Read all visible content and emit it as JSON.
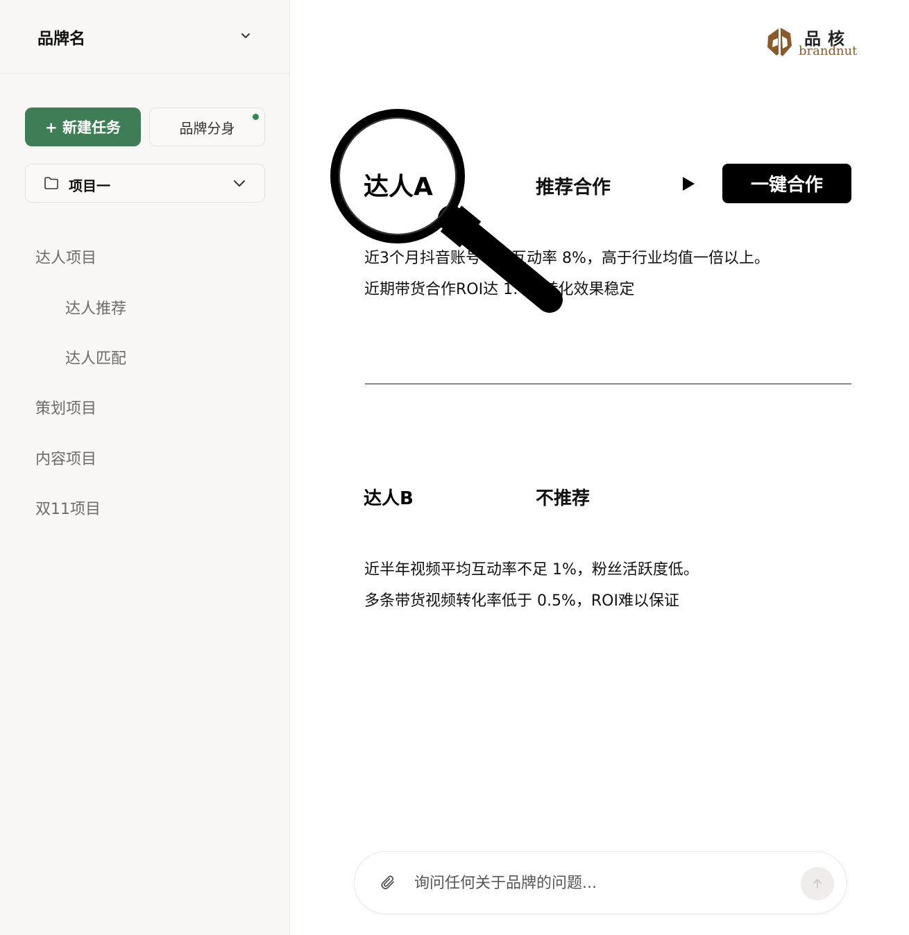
{
  "sidebar": {
    "brand_name": "品牌名",
    "new_task_label": "+ 新建任务",
    "brand_clone_label": "品牌分身",
    "project_select_value": "项目一",
    "nav": [
      {
        "label": "达人项目",
        "level": 1
      },
      {
        "label": "达人推荐",
        "level": 2
      },
      {
        "label": "达人匹配",
        "level": 2
      },
      {
        "label": "策划项目",
        "level": 1
      },
      {
        "label": "内容项目",
        "level": 1
      },
      {
        "label": "双11项目",
        "level": 1
      }
    ]
  },
  "logo": {
    "cn": "品核",
    "en": "brandnut"
  },
  "influencers": [
    {
      "name": "达人A",
      "recommendation": "推荐合作",
      "action_label": "一键合作",
      "lines": [
        "近3个月抖音账号平均互动率 8%，高于行业均值一倍以上。",
        "近期带货合作ROI达 1:4，转化效果稳定"
      ]
    },
    {
      "name": "达人B",
      "recommendation": "不推荐",
      "lines": [
        "近半年视频平均互动率不足 1%，粉丝活跃度低。",
        "多条带货视频转化率低于 0.5%，ROI难以保证"
      ]
    }
  ],
  "chat": {
    "placeholder": "询问任何关于品牌的问题..."
  },
  "colors": {
    "primary_green": "#3e7d55",
    "sidebar_bg": "#f8f7f5",
    "logo_brown": "#8b5a2b",
    "status_dot": "#2f8a4d"
  },
  "icons": {
    "brand_dropdown": "chevron-down-icon",
    "folder": "folder-icon",
    "play": "play-icon",
    "magnifier": "magnifying-glass-icon",
    "attach": "paperclip-icon",
    "send": "arrow-up-icon"
  }
}
